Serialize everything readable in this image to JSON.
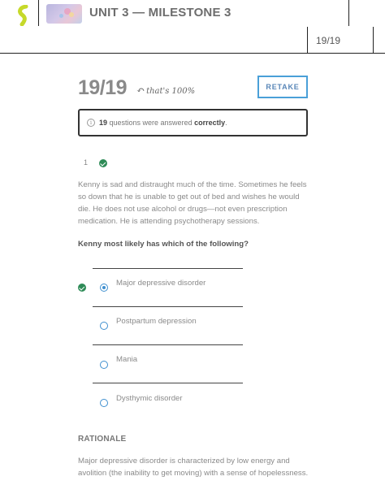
{
  "header": {
    "title": "UNIT 3 — MILESTONE 3",
    "score_label": "19/19"
  },
  "summary": {
    "score": "19/19",
    "annotation": "that's 100%",
    "retake_label": "RETAKE",
    "info_icon": "i",
    "info_count": "19",
    "info_mid": " questions were answered ",
    "info_emph": "correctly",
    "info_end": "."
  },
  "question": {
    "number": "1",
    "status": "correct",
    "stem": "Kenny is sad and distraught much of the time. Sometimes he feels so down that he is unable to get out of bed and wishes he would die. He does not use alcohol or drugs—not even prescription medication. He is attending psychotherapy sessions.",
    "prompt": "Kenny most likely has which of the following?",
    "answers": [
      {
        "label": "Major depressive disorder",
        "selected": true,
        "correct": true
      },
      {
        "label": "Postpartum depression",
        "selected": false,
        "correct": false
      },
      {
        "label": "Mania",
        "selected": false,
        "correct": false
      },
      {
        "label": "Dysthymic disorder",
        "selected": false,
        "correct": false
      }
    ]
  },
  "rationale": {
    "heading": "RATIONALE",
    "text": "Major depressive disorder is characterized by low energy and avolition (the inability to get moving) with a sense of hopelessness."
  },
  "colors": {
    "accent": "#3f8fcf",
    "correct": "#2e8b57",
    "logo": "#c6d92a"
  },
  "icons": [
    "logo-icon",
    "course-thumbnail",
    "arrow-icon",
    "info-icon",
    "check-icon",
    "radio-icon"
  ]
}
